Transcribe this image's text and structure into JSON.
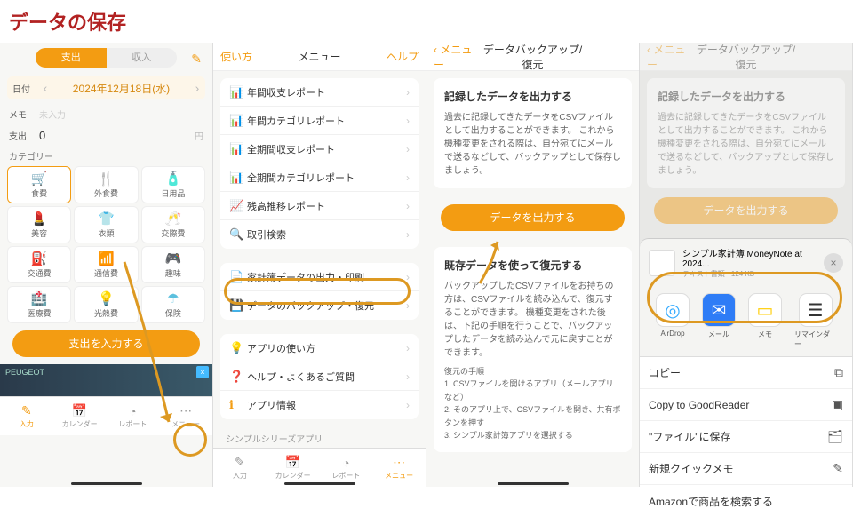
{
  "title": "データの保存",
  "p1": {
    "seg": {
      "on": "支出",
      "off": "収入"
    },
    "date_lbl": "日付",
    "date": "2024年12月18日(水)",
    "memo_lbl": "メモ",
    "memo_ph": "未入力",
    "amt_lbl": "支出",
    "amt": "0",
    "unit": "円",
    "cat_lbl": "カテゴリー",
    "cats": [
      {
        "n": "食費",
        "i": "🛒",
        "c": "c-or"
      },
      {
        "n": "外食費",
        "i": "🍴",
        "c": "c-ye"
      },
      {
        "n": "日用品",
        "i": "🧴",
        "c": "c-gr"
      },
      {
        "n": "",
        "i": "",
        "c": ""
      },
      {
        "n": "美容",
        "i": "💄",
        "c": "c-pk"
      },
      {
        "n": "衣類",
        "i": "👕",
        "c": "c-bl"
      },
      {
        "n": "交際費",
        "i": "🥂",
        "c": "c-ye"
      },
      {
        "n": "",
        "i": "",
        "c": ""
      },
      {
        "n": "交通費",
        "i": "⛽",
        "c": "c-bl"
      },
      {
        "n": "通信費",
        "i": "📶",
        "c": "c-gr"
      },
      {
        "n": "趣味",
        "i": "🎮",
        "c": "c-gr"
      },
      {
        "n": "",
        "i": "",
        "c": ""
      },
      {
        "n": "医療費",
        "i": "🏥",
        "c": "c-pk"
      },
      {
        "n": "光熱費",
        "i": "💡",
        "c": "c-ye"
      },
      {
        "n": "保険",
        "i": "☂",
        "c": "c-bl"
      },
      {
        "n": "",
        "i": "",
        "c": ""
      }
    ],
    "btn": "支出を入力する",
    "ad": "PEUGEOT",
    "tabs": [
      {
        "i": "✎",
        "n": "入力"
      },
      {
        "i": "📅",
        "n": "カレンダー"
      },
      {
        "i": "◔",
        "n": "レポート"
      },
      {
        "i": "⋯",
        "n": "メニュー"
      }
    ]
  },
  "p2": {
    "hdr": {
      "l": "使い方",
      "c": "メニュー",
      "r": "ヘルプ"
    },
    "g1": [
      {
        "i": "📊",
        "t": "年間収支レポート"
      },
      {
        "i": "📊",
        "t": "年間カテゴリレポート"
      },
      {
        "i": "📊",
        "t": "全期間収支レポート"
      },
      {
        "i": "📊",
        "t": "全期間カテゴリレポート"
      },
      {
        "i": "📈",
        "t": "残高推移レポート"
      },
      {
        "i": "🔍",
        "t": "取引検索"
      }
    ],
    "g2": [
      {
        "i": "📄",
        "t": "家計簿データの出力・印刷"
      },
      {
        "i": "💾",
        "t": "データのバックアップ・復元"
      }
    ],
    "g3": [
      {
        "i": "💡",
        "t": "アプリの使い方"
      },
      {
        "i": "❓",
        "t": "ヘルプ・よくあるご質問"
      },
      {
        "i": "ℹ",
        "t": "アプリ情報"
      }
    ],
    "sect": "シンプルシリーズアプリ",
    "tabs": [
      {
        "i": "✎",
        "n": "入力"
      },
      {
        "i": "📅",
        "n": "カレンダー"
      },
      {
        "i": "◔",
        "n": "レポート"
      },
      {
        "i": "⋯",
        "n": "メニュー"
      }
    ]
  },
  "p3": {
    "hdr": {
      "l": "メニュー",
      "c": "データバックアップ/復元"
    },
    "c1": {
      "h": "記録したデータを出力する",
      "p": "過去に記録してきたデータをCSVファイルとして出力することができます。\nこれから機種変更をされる際は、自分宛てにメールで送るなどして、バックアップとして保存しましょう。"
    },
    "btn": "データを出力する",
    "c2": {
      "h": "既存データを使って復元する",
      "p": "バックアップしたCSVファイルをお持ちの方は、CSVファイルを読み込んで、復元することができます。\n機種変更をされた後は、下記の手順を行うことで、バックアップしたデータを読み込んで元に戻すことができます。",
      "sh": "復元の手順",
      "s": [
        "1. CSVファイルを開けるアプリ（メールアプリなど）",
        "2. そのアプリ上で、CSVファイルを開き、共有ボタンを押す",
        "3. シンプル家計簿アプリを選択する"
      ]
    }
  },
  "p4": {
    "hdr": {
      "l": "メニュー",
      "c": "データバックアップ/復元"
    },
    "c1": {
      "h": "記録したデータを出力する",
      "p": "過去に記録してきたデータをCSVファイルとして出力することができます。\nこれから機種変更をされる際は、自分宛てにメールで送るなどして、バックアップとして保存しましょう。"
    },
    "btn": "データを出力する",
    "share": {
      "file": "シンプル家計簿 MoneyNote at 2024...",
      "sub": "テキスト書類 · 124 KB",
      "apps": [
        {
          "n": "AirDrop",
          "bg": "#fff",
          "fg": "#3af",
          "i": "◎"
        },
        {
          "n": "メール",
          "bg": "#2e7cf6",
          "i": "✉"
        },
        {
          "n": "メモ",
          "bg": "#fff",
          "fg": "#fc0",
          "i": "▭"
        },
        {
          "n": "リマインダー",
          "bg": "#fff",
          "fg": "#333",
          "i": "☰"
        }
      ],
      "list": [
        {
          "t": "コピー",
          "i": "⧉"
        },
        {
          "t": "Copy to GoodReader",
          "i": "▣"
        },
        {
          "t": "\"ファイル\"に保存",
          "i": "🗂"
        },
        {
          "t": "新規クイックメモ",
          "i": "✎"
        },
        {
          "t": "Amazonで商品を検索する",
          "i": ""
        }
      ]
    }
  }
}
